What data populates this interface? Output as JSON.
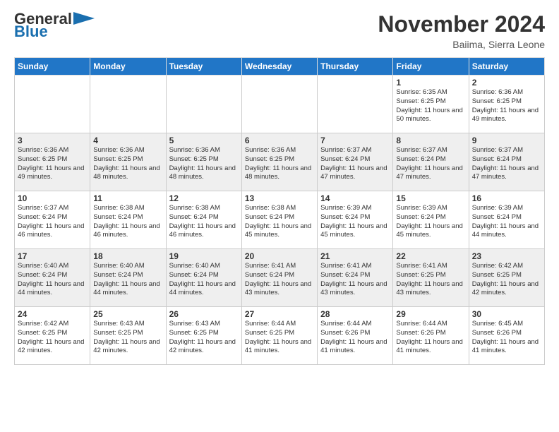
{
  "logo": {
    "general": "General",
    "blue": "Blue"
  },
  "title": "November 2024",
  "location": "Baiima, Sierra Leone",
  "weekdays": [
    "Sunday",
    "Monday",
    "Tuesday",
    "Wednesday",
    "Thursday",
    "Friday",
    "Saturday"
  ],
  "weeks": [
    [
      {
        "day": "",
        "info": ""
      },
      {
        "day": "",
        "info": ""
      },
      {
        "day": "",
        "info": ""
      },
      {
        "day": "",
        "info": ""
      },
      {
        "day": "",
        "info": ""
      },
      {
        "day": "1",
        "info": "Sunrise: 6:35 AM\nSunset: 6:25 PM\nDaylight: 11 hours and 50 minutes."
      },
      {
        "day": "2",
        "info": "Sunrise: 6:36 AM\nSunset: 6:25 PM\nDaylight: 11 hours and 49 minutes."
      }
    ],
    [
      {
        "day": "3",
        "info": "Sunrise: 6:36 AM\nSunset: 6:25 PM\nDaylight: 11 hours and 49 minutes."
      },
      {
        "day": "4",
        "info": "Sunrise: 6:36 AM\nSunset: 6:25 PM\nDaylight: 11 hours and 48 minutes."
      },
      {
        "day": "5",
        "info": "Sunrise: 6:36 AM\nSunset: 6:25 PM\nDaylight: 11 hours and 48 minutes."
      },
      {
        "day": "6",
        "info": "Sunrise: 6:36 AM\nSunset: 6:25 PM\nDaylight: 11 hours and 48 minutes."
      },
      {
        "day": "7",
        "info": "Sunrise: 6:37 AM\nSunset: 6:24 PM\nDaylight: 11 hours and 47 minutes."
      },
      {
        "day": "8",
        "info": "Sunrise: 6:37 AM\nSunset: 6:24 PM\nDaylight: 11 hours and 47 minutes."
      },
      {
        "day": "9",
        "info": "Sunrise: 6:37 AM\nSunset: 6:24 PM\nDaylight: 11 hours and 47 minutes."
      }
    ],
    [
      {
        "day": "10",
        "info": "Sunrise: 6:37 AM\nSunset: 6:24 PM\nDaylight: 11 hours and 46 minutes."
      },
      {
        "day": "11",
        "info": "Sunrise: 6:38 AM\nSunset: 6:24 PM\nDaylight: 11 hours and 46 minutes."
      },
      {
        "day": "12",
        "info": "Sunrise: 6:38 AM\nSunset: 6:24 PM\nDaylight: 11 hours and 46 minutes."
      },
      {
        "day": "13",
        "info": "Sunrise: 6:38 AM\nSunset: 6:24 PM\nDaylight: 11 hours and 45 minutes."
      },
      {
        "day": "14",
        "info": "Sunrise: 6:39 AM\nSunset: 6:24 PM\nDaylight: 11 hours and 45 minutes."
      },
      {
        "day": "15",
        "info": "Sunrise: 6:39 AM\nSunset: 6:24 PM\nDaylight: 11 hours and 45 minutes."
      },
      {
        "day": "16",
        "info": "Sunrise: 6:39 AM\nSunset: 6:24 PM\nDaylight: 11 hours and 44 minutes."
      }
    ],
    [
      {
        "day": "17",
        "info": "Sunrise: 6:40 AM\nSunset: 6:24 PM\nDaylight: 11 hours and 44 minutes."
      },
      {
        "day": "18",
        "info": "Sunrise: 6:40 AM\nSunset: 6:24 PM\nDaylight: 11 hours and 44 minutes."
      },
      {
        "day": "19",
        "info": "Sunrise: 6:40 AM\nSunset: 6:24 PM\nDaylight: 11 hours and 44 minutes."
      },
      {
        "day": "20",
        "info": "Sunrise: 6:41 AM\nSunset: 6:24 PM\nDaylight: 11 hours and 43 minutes."
      },
      {
        "day": "21",
        "info": "Sunrise: 6:41 AM\nSunset: 6:24 PM\nDaylight: 11 hours and 43 minutes."
      },
      {
        "day": "22",
        "info": "Sunrise: 6:41 AM\nSunset: 6:25 PM\nDaylight: 11 hours and 43 minutes."
      },
      {
        "day": "23",
        "info": "Sunrise: 6:42 AM\nSunset: 6:25 PM\nDaylight: 11 hours and 42 minutes."
      }
    ],
    [
      {
        "day": "24",
        "info": "Sunrise: 6:42 AM\nSunset: 6:25 PM\nDaylight: 11 hours and 42 minutes."
      },
      {
        "day": "25",
        "info": "Sunrise: 6:43 AM\nSunset: 6:25 PM\nDaylight: 11 hours and 42 minutes."
      },
      {
        "day": "26",
        "info": "Sunrise: 6:43 AM\nSunset: 6:25 PM\nDaylight: 11 hours and 42 minutes."
      },
      {
        "day": "27",
        "info": "Sunrise: 6:44 AM\nSunset: 6:25 PM\nDaylight: 11 hours and 41 minutes."
      },
      {
        "day": "28",
        "info": "Sunrise: 6:44 AM\nSunset: 6:26 PM\nDaylight: 11 hours and 41 minutes."
      },
      {
        "day": "29",
        "info": "Sunrise: 6:44 AM\nSunset: 6:26 PM\nDaylight: 11 hours and 41 minutes."
      },
      {
        "day": "30",
        "info": "Sunrise: 6:45 AM\nSunset: 6:26 PM\nDaylight: 11 hours and 41 minutes."
      }
    ]
  ]
}
